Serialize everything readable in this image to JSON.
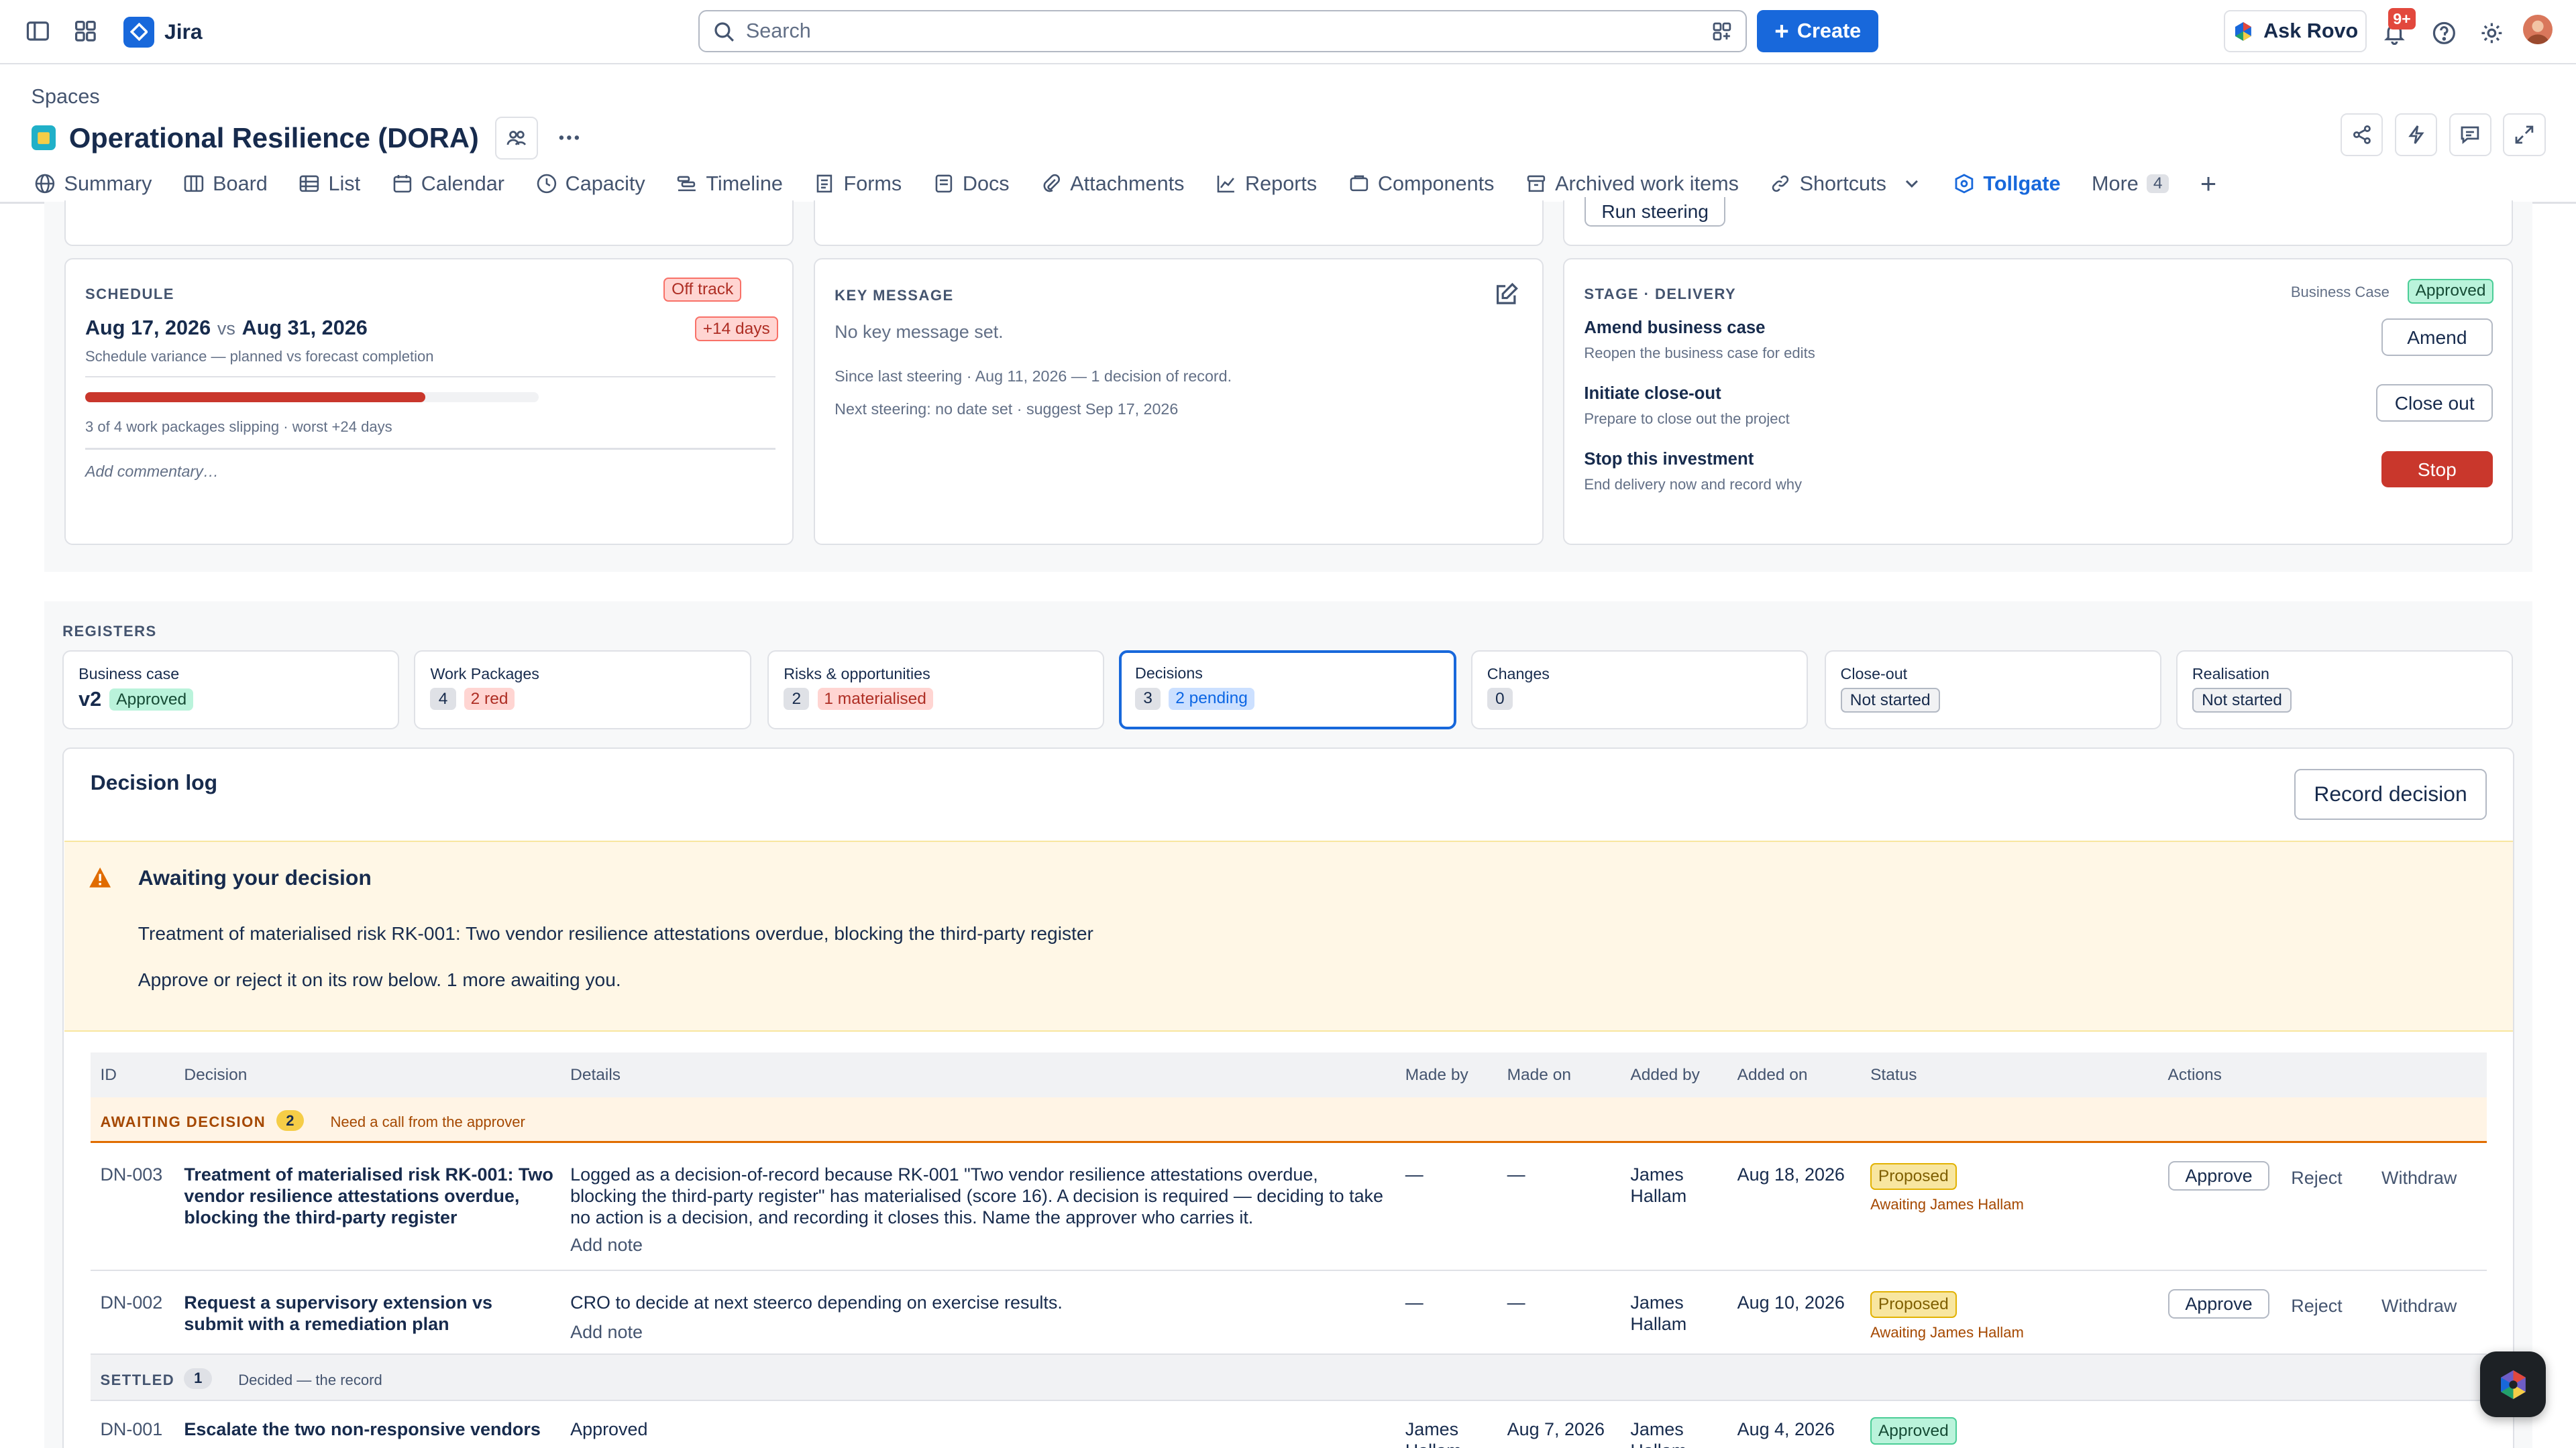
{
  "app": {
    "name": "Jira"
  },
  "search": {
    "placeholder": "Search"
  },
  "create_label": "Create",
  "rovo_label": "Ask Rovo",
  "notifications_badge": "9+",
  "breadcrumb": "Spaces",
  "project": {
    "title": "Operational Resilience (DORA)"
  },
  "tabs": [
    {
      "label": "Summary"
    },
    {
      "label": "Board"
    },
    {
      "label": "List"
    },
    {
      "label": "Calendar"
    },
    {
      "label": "Capacity"
    },
    {
      "label": "Timeline"
    },
    {
      "label": "Forms"
    },
    {
      "label": "Docs"
    },
    {
      "label": "Attachments"
    },
    {
      "label": "Reports"
    },
    {
      "label": "Components"
    },
    {
      "label": "Archived work items"
    },
    {
      "label": "Shortcuts"
    },
    {
      "label": "Tollgate"
    },
    {
      "label": "More"
    }
  ],
  "tabs_more_count": "4",
  "run_steering_label": "Run steering",
  "schedule": {
    "label": "SCHEDULE",
    "status": "Off track",
    "planned": "Aug 17, 2026",
    "vs": "vs",
    "forecast": "Aug 31, 2026",
    "delta": "+14 days",
    "subtitle": "Schedule variance — planned vs forecast completion",
    "progress": 0.75,
    "slipping": "3 of 4 work packages slipping · worst +24 days",
    "commentary": "Add commentary…"
  },
  "key_message": {
    "label": "KEY MESSAGE",
    "empty": "No key message set.",
    "since": "Since last steering · Aug 11, 2026 — 1 decision of record.",
    "next": "Next steering: no date set · suggest Sep 17, 2026"
  },
  "stage": {
    "label": "STAGE · DELIVERY",
    "bc_label": "Business Case",
    "bc_status": "Approved",
    "actions": [
      {
        "title": "Amend business case",
        "desc": "Reopen the business case for edits",
        "button": "Amend"
      },
      {
        "title": "Initiate close-out",
        "desc": "Prepare to close out the project",
        "button": "Close out"
      },
      {
        "title": "Stop this investment",
        "desc": "End delivery now and record why",
        "button": "Stop"
      }
    ]
  },
  "registers": {
    "label": "REGISTERS",
    "items": [
      {
        "title": "Business case",
        "count": "v2",
        "badge": "Approved"
      },
      {
        "title": "Work Packages",
        "count": "4",
        "badge": "2 red"
      },
      {
        "title": "Risks & opportunities",
        "count": "2",
        "badge": "1 materialised"
      },
      {
        "title": "Decisions",
        "count": "3",
        "badge": "2 pending"
      },
      {
        "title": "Changes",
        "count": "0",
        "badge": ""
      },
      {
        "title": "Close-out",
        "count": "",
        "badge": "Not started"
      },
      {
        "title": "Realisation",
        "count": "",
        "badge": "Not started"
      }
    ]
  },
  "decision_log": {
    "title": "Decision log",
    "record_button": "Record decision",
    "banner": {
      "title": "Awaiting your decision",
      "text": "Treatment of materialised risk RK-001: Two vendor resilience attestations overdue, blocking the third-party register",
      "hint": "Approve or reject it on its row below. 1 more awaiting you."
    },
    "columns": [
      "ID",
      "Decision",
      "Details",
      "Made by",
      "Made on",
      "Added by",
      "Added on",
      "Status",
      "Actions"
    ],
    "awaiting_group": {
      "label": "AWAITING DECISION",
      "count": "2",
      "note": "Need a call from the approver"
    },
    "settled_group": {
      "label": "SETTLED",
      "count": "1",
      "note": "Decided — the record"
    },
    "rows": [
      {
        "id": "DN-003",
        "decision": "Treatment of materialised risk RK-001: Two vendor resilience attestations overdue, blocking the third-party register",
        "details": "Logged as a decision-of-record because RK-001 \"Two vendor resilience attestations overdue, blocking the third-party register\" has materialised (score 16). A decision is required — deciding to take no action is a decision, and recording it closes this. Name the approver who carries it.",
        "add_note": "Add note",
        "made_by": "—",
        "made_on": "—",
        "added_by": "James Hallam",
        "added_on": "Aug 18, 2026",
        "status": "Proposed",
        "awaiting": "Awaiting James Hallam",
        "approve": "Approve",
        "reject": "Reject",
        "withdraw": "Withdraw"
      },
      {
        "id": "DN-002",
        "decision": "Request a supervisory extension vs submit with a remediation plan",
        "details": "CRO to decide at next steerco depending on exercise results.",
        "add_note": "Add note",
        "made_by": "—",
        "made_on": "—",
        "added_by": "James Hallam",
        "added_on": "Aug 10, 2026",
        "status": "Proposed",
        "awaiting": "Awaiting James Hallam",
        "approve": "Approve",
        "reject": "Reject",
        "withdraw": "Withdraw"
      },
      {
        "id": "DN-001",
        "decision": "Escalate the two non-responsive vendors",
        "details": "Approved",
        "made_by": "James Hallam",
        "made_on": "Aug 7, 2026",
        "added_by": "James Hallam",
        "added_on": "Aug 4, 2026",
        "status": "Approved"
      }
    ]
  },
  "colors": {
    "accent": "#1868db",
    "danger": "#c9372c",
    "warning_bg": "#fff7e6"
  }
}
